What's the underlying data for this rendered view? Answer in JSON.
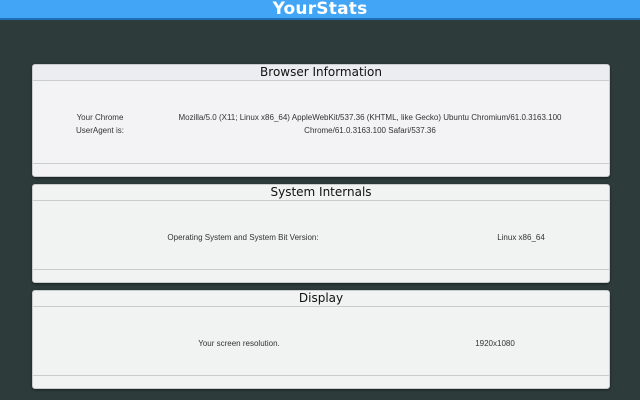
{
  "app": {
    "title": "YourStats",
    "header_color": "#42a5f5"
  },
  "browser": {
    "heading": "Browser Information",
    "label_lines": [
      "Your Chrome",
      "UserAgent is:"
    ],
    "value_lines": [
      "Mozilla/5.0 (X11; Linux x86_64) AppleWebKit/537.36 (KHTML, like Gecko) Ubuntu Chromium/61.0.3163.100",
      "Chrome/61.0.3163.100 Safari/537.36"
    ]
  },
  "system": {
    "heading": "System Internals",
    "label": "Operating System and System Bit Version:",
    "value": "Linux x86_64"
  },
  "display": {
    "heading": "Display",
    "label": "Your screen resolution.",
    "value": "1920x1080"
  }
}
